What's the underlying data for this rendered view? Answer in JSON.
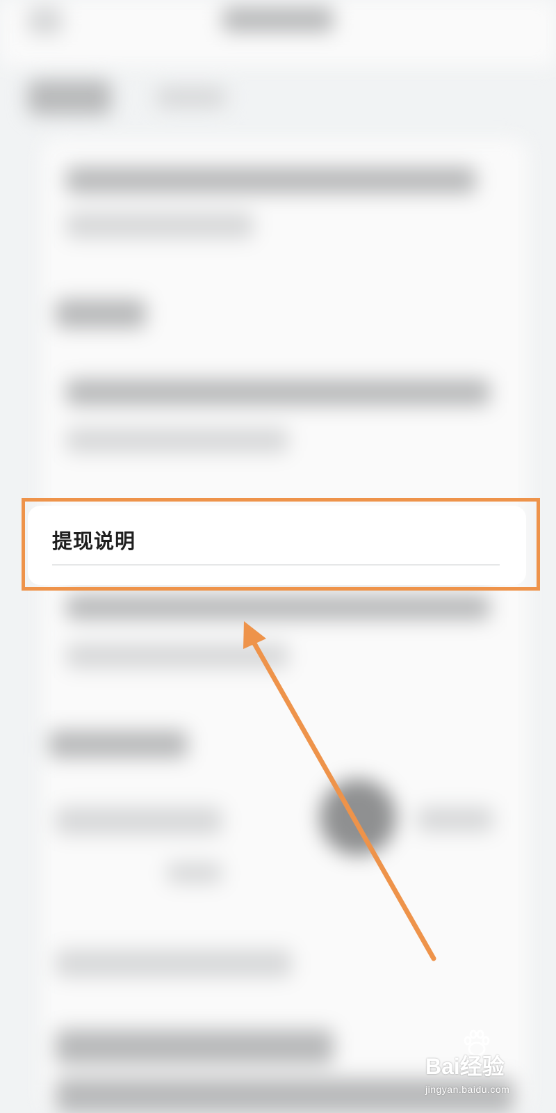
{
  "card": {
    "title": "提现说明"
  },
  "watermark": {
    "logo": "Bai经验",
    "subtext": "jingyan.baidu.com"
  },
  "colors": {
    "highlight": "#ee934a",
    "background": "#f1f3f4",
    "card": "#ffffff"
  },
  "icons": [
    "arrow-up-left-icon",
    "baidu-paw-icon"
  ]
}
